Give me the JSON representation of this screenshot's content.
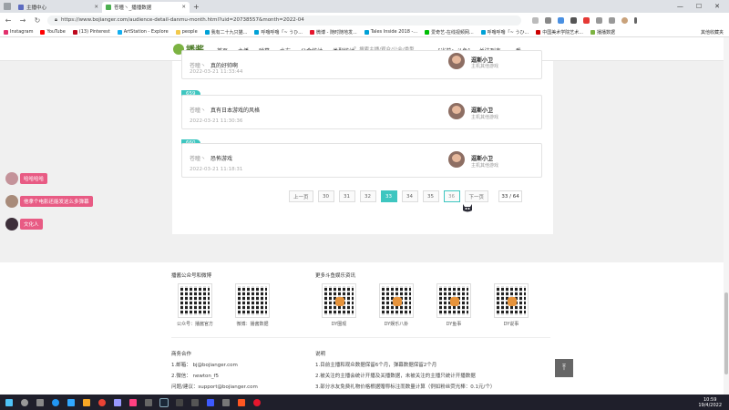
{
  "browser": {
    "tabs": [
      {
        "label": "主播中心",
        "active": false
      },
      {
        "label": "苍瞳丶_播播数据",
        "active": true
      }
    ],
    "url": "https://www.bojianger.com/audience-detail-danmu-month.html?uid=20738557&month=2022-04",
    "window_controls": {
      "minimize": "—",
      "maximize": "☐",
      "close": "✕"
    }
  },
  "bookmarks": [
    {
      "label": "Instagram",
      "color": "#e1306c"
    },
    {
      "label": "YouTube",
      "color": "#ff0000"
    },
    {
      "label": "(13) Pinterest",
      "color": "#bd081c"
    },
    {
      "label": "ArtStation - Explore",
      "color": "#13aff0"
    },
    {
      "label": "people",
      "color": "#f2c94c"
    },
    {
      "label": "我有二十九只猫...",
      "color": "#00a1d6"
    },
    {
      "label": "呼噜呼噜「~ うひ...",
      "color": "#00a1d6"
    },
    {
      "label": "微博 - 随时随地发...",
      "color": "#e6162d"
    },
    {
      "label": "Tales Inside 2018 -...",
      "color": "#00a1d6"
    },
    {
      "label": "爱奇艺-在线视频网...",
      "color": "#00be06"
    },
    {
      "label": "呼噜呼噜「~ うひ...",
      "color": "#00a1d6"
    },
    {
      "label": "中国美术学院艺术...",
      "color": "#c00"
    },
    {
      "label": "播播数据",
      "color": "#7cb342"
    }
  ],
  "bookmarks_other": "其他收藏夹",
  "site": {
    "logo_text": "播酱",
    "nav": [
      "首页",
      "主播",
      "弹幕",
      "水友",
      "公会统计",
      "类型统计"
    ],
    "search_placeholder": "搜索主播/观众/公会/类型",
    "platform_label": "[当前：斗鱼]",
    "platform_links": [
      "关注列表",
      "一番"
    ]
  },
  "danmu_items": [
    {
      "index": "",
      "user": "苍瞳丶",
      "text": "真的好帅啊",
      "time": "2022-03-21 11:33:44",
      "anchor": "逗斯小卫",
      "anchor_sub": "主机其他游戏"
    },
    {
      "index": "659",
      "user": "苍瞳丶",
      "text": "真有日本游戏的风格",
      "time": "2022-03-21 11:30:36",
      "anchor": "逗斯小卫",
      "anchor_sub": "主机其他游戏"
    },
    {
      "index": "660",
      "user": "苍瞳丶",
      "text": "恐怖游戏",
      "time": "2022-03-21 11:18:31",
      "anchor": "逗斯小卫",
      "anchor_sub": "主机其他游戏"
    }
  ],
  "pagination": {
    "prev": "上一页",
    "pages": [
      "30",
      "31",
      "32",
      "33",
      "34",
      "35",
      "36"
    ],
    "current": "33",
    "next": "下一页",
    "info": "33 / 64"
  },
  "floating_danmaku": [
    {
      "text": "哈哈哈哈"
    },
    {
      "text": "他拿个电影还能发这么多弹幕"
    },
    {
      "text": "文化人"
    }
  ],
  "footer": {
    "official_title": "播酱公众号和微博",
    "official_qr": [
      {
        "caption": "公众号：播酱官方"
      },
      {
        "caption": "微博：播酱数据"
      }
    ],
    "douyu_title": "更多斗鱼娱乐资讯",
    "douyu_qr": [
      {
        "caption": "DY圈观"
      },
      {
        "caption": "DY娱乐八卦"
      },
      {
        "caption": "DY鱼事"
      },
      {
        "caption": "DY说事"
      }
    ],
    "coop_title": "商务合作",
    "coop_lines": [
      "1.邮箱： bj@bojianger.com",
      "2.微信： newton_f5",
      "问题/建议：support@bojianger.com"
    ],
    "notes_title": "说明",
    "notes_lines": [
      "1.目前主播和观众数据保留6个月，弹幕数据保留2个月",
      "2.被关注的主播会统计开播及关播数据，未被关注的主播只统计开播数据",
      "3.部分水友免费礼物价格根据赠称标注而数量计算（例如粉丝荧光棒：0.1元/个）"
    ],
    "to_top_icon": "arrow-up-to-line"
  },
  "taskbar": {
    "time": "10:59",
    "date": "19/4/2022"
  }
}
